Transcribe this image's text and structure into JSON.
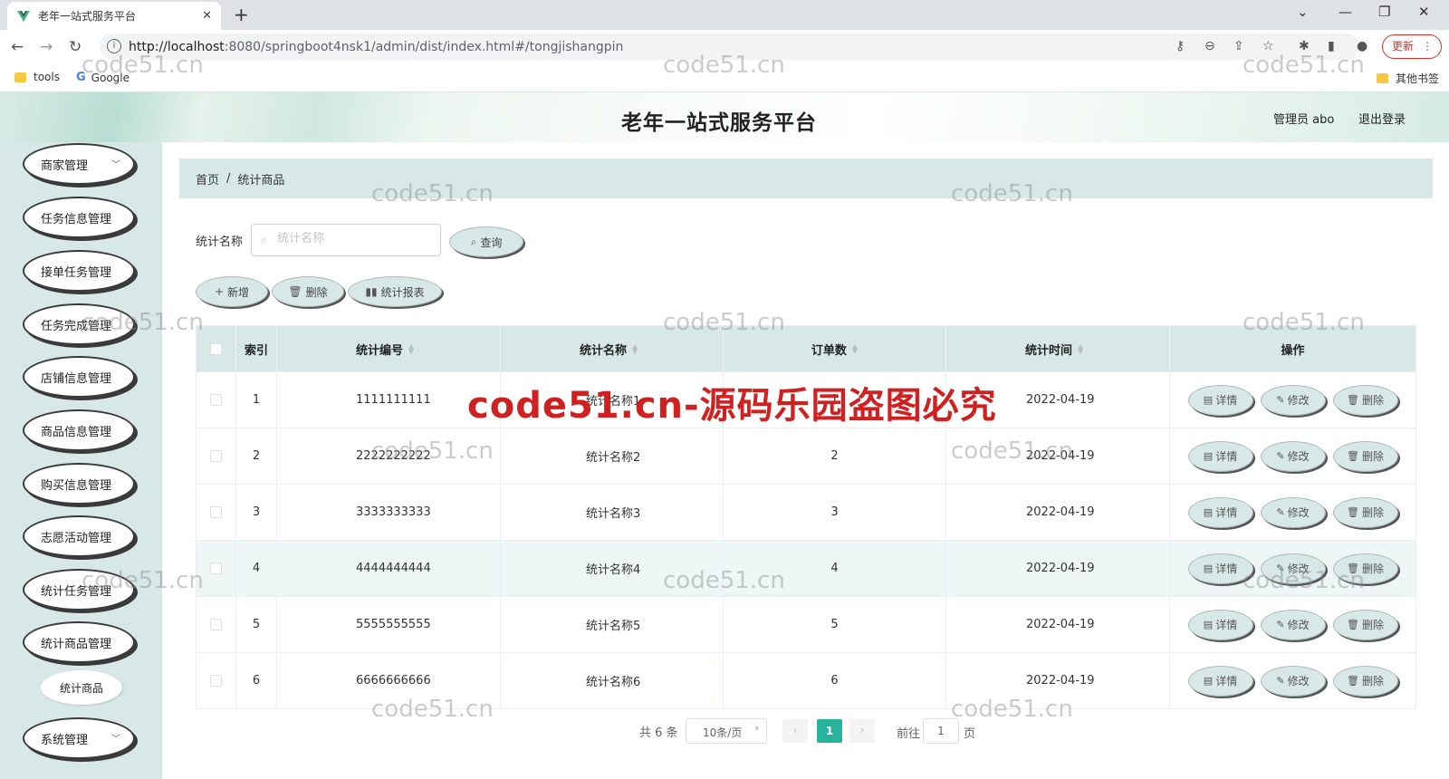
{
  "browser": {
    "tab_title": "老年一站式服务平台",
    "url_host": "http://localhost",
    "url_path": ":8080/springboot4nsk1/admin/dist/index.html#/tongjishangpin",
    "update_label": "更新",
    "bookmarks": [
      {
        "label": "tools",
        "icon": "folder-icon"
      },
      {
        "label": "Google",
        "icon": "google-icon"
      }
    ],
    "other_bookmarks": "其他书签"
  },
  "header": {
    "title": "老年一站式服务平台",
    "admin_label": "管理员 abo",
    "logout_label": "退出登录"
  },
  "sidebar": {
    "items": [
      {
        "label": "商家管理",
        "has_chevron": true
      },
      {
        "label": "任务信息管理"
      },
      {
        "label": "接单任务管理"
      },
      {
        "label": "任务完成管理"
      },
      {
        "label": "店铺信息管理"
      },
      {
        "label": "商品信息管理"
      },
      {
        "label": "购买信息管理"
      },
      {
        "label": "志愿活动管理"
      },
      {
        "label": "统计任务管理"
      },
      {
        "label": "统计商品管理"
      },
      {
        "label": "系统管理",
        "has_chevron": true
      }
    ],
    "submenu": {
      "label": "统计商品"
    }
  },
  "breadcrumb": {
    "home": "首页",
    "separator": "/",
    "current": "统计商品"
  },
  "search": {
    "label": "统计名称",
    "placeholder": "统计名称",
    "query_button": "查询"
  },
  "actions": {
    "add": "新增",
    "delete": "删除",
    "report": "统计报表"
  },
  "table": {
    "columns": [
      "",
      "索引",
      "统计编号",
      "统计名称",
      "订单数",
      "统计时间",
      "操作"
    ],
    "rows": [
      {
        "index": "1",
        "code": "1111111111",
        "name": "统计名称1",
        "orders": "1",
        "date": "2022-04-19"
      },
      {
        "index": "2",
        "code": "2222222222",
        "name": "统计名称2",
        "orders": "2",
        "date": "2022-04-19"
      },
      {
        "index": "3",
        "code": "3333333333",
        "name": "统计名称3",
        "orders": "3",
        "date": "2022-04-19"
      },
      {
        "index": "4",
        "code": "4444444444",
        "name": "统计名称4",
        "orders": "4",
        "date": "2022-04-19"
      },
      {
        "index": "5",
        "code": "5555555555",
        "name": "统计名称5",
        "orders": "5",
        "date": "2022-04-19"
      },
      {
        "index": "6",
        "code": "6666666666",
        "name": "统计名称6",
        "orders": "6",
        "date": "2022-04-19"
      }
    ],
    "row_actions": {
      "detail": "详情",
      "edit": "修改",
      "delete": "删除"
    }
  },
  "pagination": {
    "total": "共 6 条",
    "page_size": "10条/页",
    "current_page": "1",
    "goto_label": "前往",
    "goto_value": "1",
    "page_suffix": "页"
  },
  "watermark": {
    "text": "code51.cn",
    "banner": "code51.cn-源码乐园盗图必究"
  },
  "colors": {
    "accent": "#27b39c",
    "sidebar_bg": "#d7e8e7",
    "watermark_red": "#d02020"
  }
}
